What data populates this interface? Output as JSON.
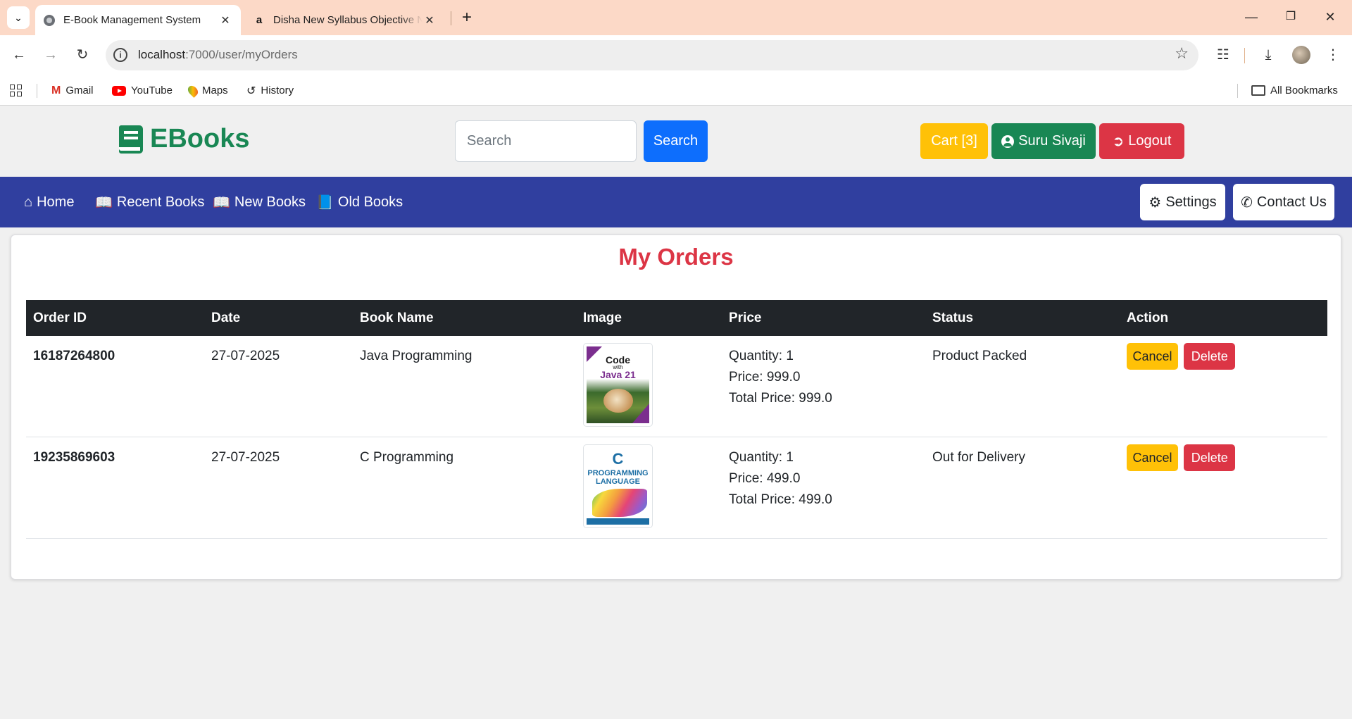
{
  "browser": {
    "tabs": [
      {
        "title": "E-Book Management System",
        "active": true
      },
      {
        "title": "Disha New Syllabus Objective N",
        "active": false
      }
    ],
    "url_host": "localhost",
    "url_path": ":7000/user/myOrders",
    "bookmarks": [
      "Gmail",
      "YouTube",
      "Maps",
      "History"
    ],
    "all_bookmarks": "All Bookmarks"
  },
  "header": {
    "brand": "EBooks",
    "search_placeholder": "Search",
    "search_button": "Search",
    "cart_label": "Cart [3]",
    "user_label": "Suru Sivaji",
    "logout_label": "Logout"
  },
  "nav": {
    "items": [
      "Home",
      "Recent Books",
      "New Books",
      "Old Books"
    ],
    "settings": "Settings",
    "contact": "Contact Us"
  },
  "orders": {
    "title": "My Orders",
    "columns": [
      "Order ID",
      "Date",
      "Book Name",
      "Image",
      "Price",
      "Status",
      "Action"
    ],
    "rows": [
      {
        "order_id": "16187264800",
        "date": "27-07-2025",
        "book": "Java Programming",
        "cover_text": [
          "Code",
          "with",
          "Java 21"
        ],
        "quantity": "Quantity: 1",
        "price": "Price: 999.0",
        "total": "Total Price: 999.0",
        "status": "Product Packed"
      },
      {
        "order_id": "19235869603",
        "date": "27-07-2025",
        "book": "C Programming",
        "cover_text": [
          "C",
          "PROGRAMMING",
          "LANGUAGE"
        ],
        "quantity": "Quantity: 1",
        "price": "Price: 499.0",
        "total": "Total Price: 499.0",
        "status": "Out for Delivery"
      }
    ],
    "cancel_label": "Cancel",
    "delete_label": "Delete"
  },
  "colors": {
    "brand_green": "#198754",
    "nav_blue": "#303f9f",
    "title_red": "#dc3545",
    "cart_yellow": "#ffc107",
    "search_blue": "#0d6efd"
  }
}
